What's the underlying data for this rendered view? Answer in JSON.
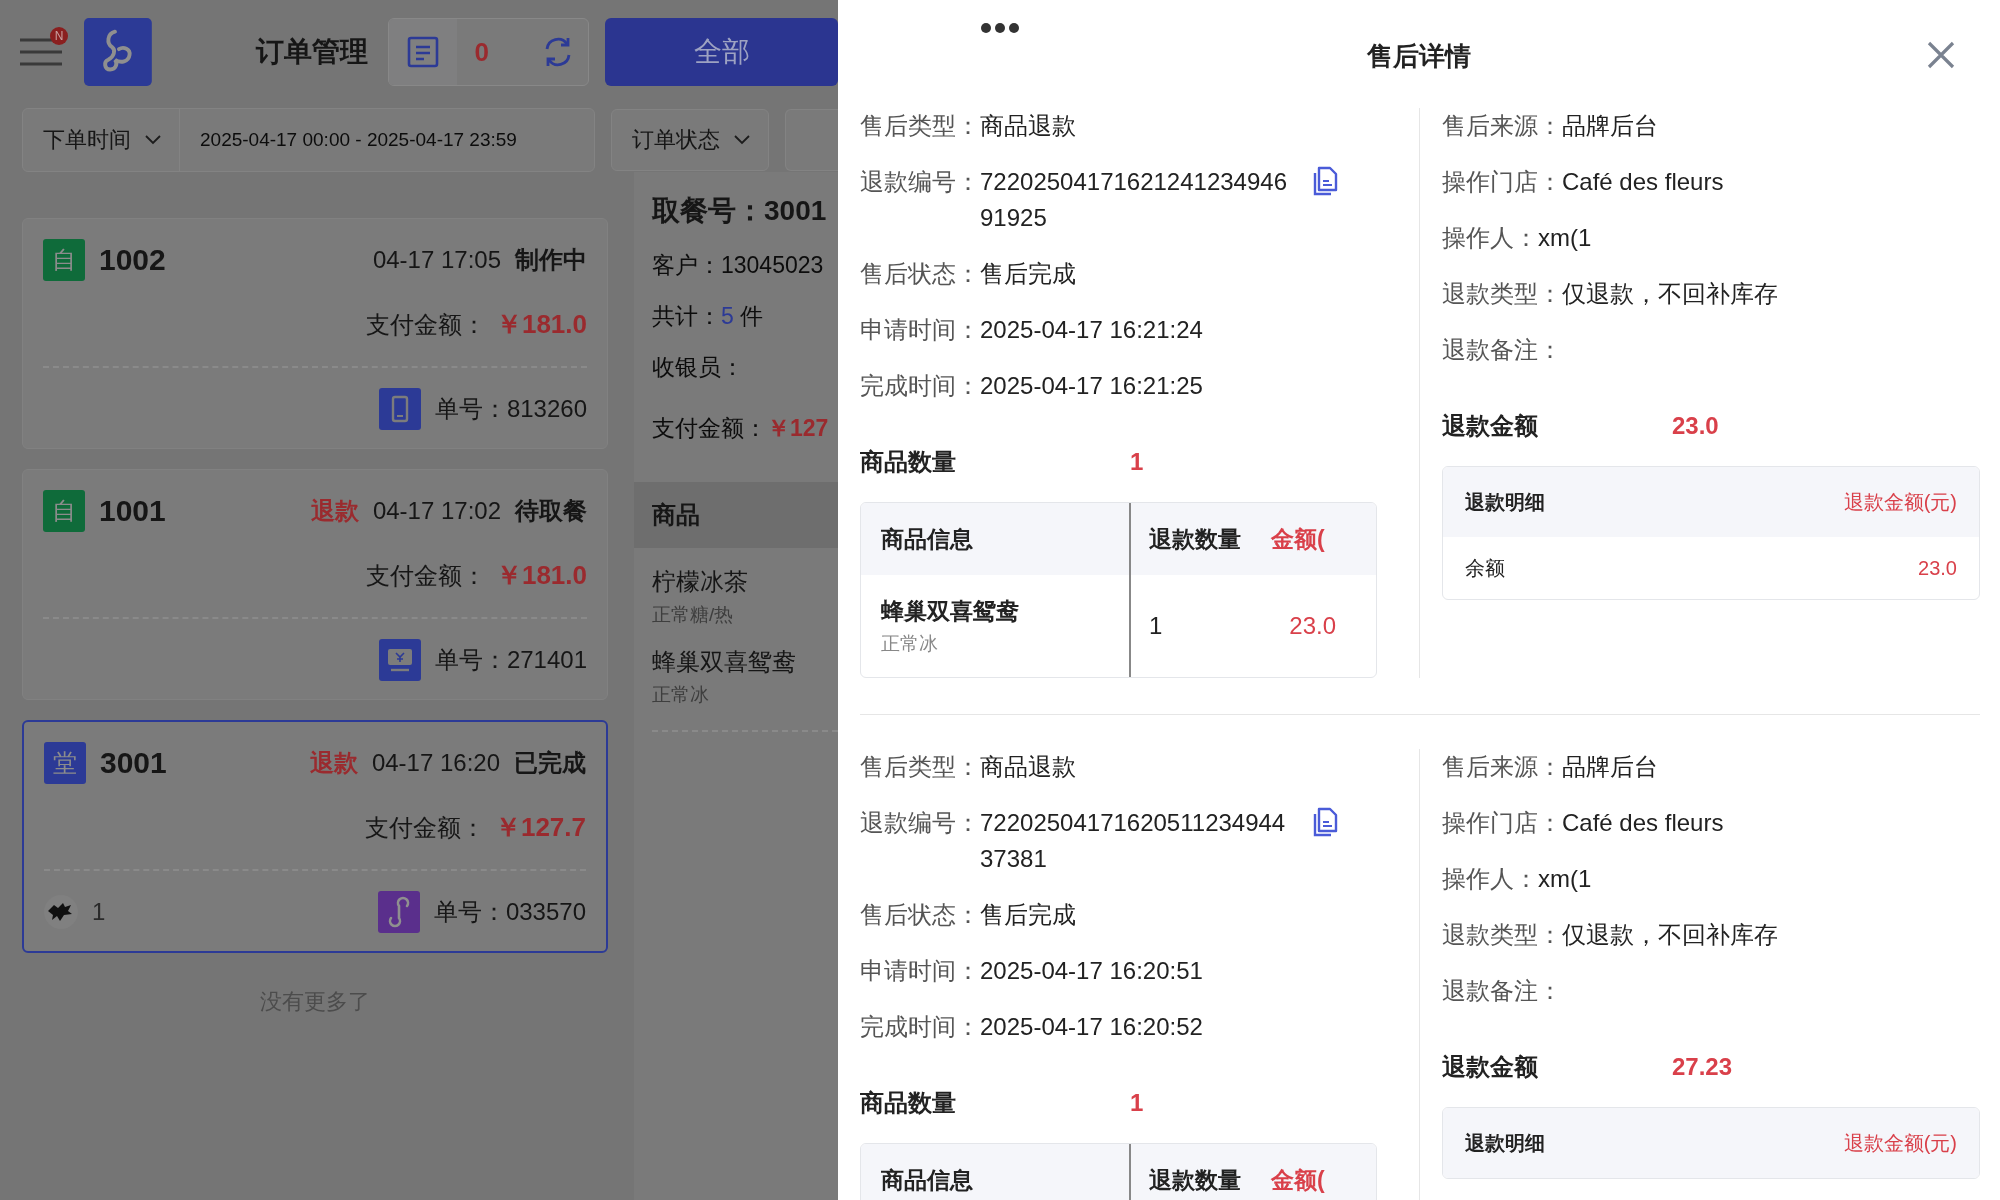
{
  "order_page": {
    "menu_badge": "N",
    "title": "订单管理",
    "pending_count": "0",
    "all_tab": "全部",
    "filters": [
      {
        "kind": "dropdown",
        "label": "下单时间"
      },
      {
        "kind": "range",
        "value": "2025-04-17 00:00 - 2025-04-17 23:59"
      },
      {
        "kind": "dropdown",
        "label": "订单状态"
      },
      {
        "kind": "cut"
      }
    ],
    "orders": [
      {
        "badge": "自",
        "color": "#0f6b3a",
        "number": "1002",
        "time": "04-17 17:05",
        "status": "制作中",
        "pay_label": "支付金额：",
        "amount": "￥181.0",
        "kind": "phone",
        "order_no_label": "单号：",
        "order_no": "813260",
        "selected": false
      },
      {
        "badge": "自",
        "color": "#0f6b3a",
        "number": "1001",
        "refund_tag": "退款",
        "time": "04-17 17:02",
        "status": "待取餐",
        "pay_label": "支付金额：",
        "amount": "￥181.0",
        "kind": "cashier",
        "order_no_label": "单号：",
        "order_no": "271401",
        "selected": false
      },
      {
        "badge": "堂",
        "color": "#2c3a96",
        "number": "3001",
        "refund_tag": "退款",
        "time": "04-17 16:20",
        "status": "已完成",
        "pay_label": "支付金额：",
        "amount": "￥127.7",
        "customer": "1",
        "kind": "mini_program",
        "order_no_label": "单号：",
        "order_no": "033570",
        "selected": true
      }
    ],
    "end_note": "没有更多了",
    "detail": {
      "pickup_label": "取餐号：",
      "pickup_no": "3001",
      "rows": [
        {
          "kind": "text",
          "label": "客户：",
          "value": "13045023"
        },
        {
          "kind": "count",
          "label": "共计：",
          "value": "5",
          "unit": "件"
        },
        {
          "kind": "text",
          "label": "收银员："
        },
        {
          "kind": "amount",
          "label": "支付金额：",
          "value": "￥127"
        }
      ],
      "items_header": "商品",
      "items": [
        {
          "name": "柠檬冰茶",
          "spec": "正常糖/热"
        },
        {
          "name": "蜂巢双喜鸳鸯",
          "spec": "正常冰"
        }
      ]
    }
  },
  "drawer": {
    "title": "售后详情",
    "records": [
      {
        "left": [
          {
            "kind": "text",
            "label": "售后类型：",
            "value": "商品退款"
          },
          {
            "kind": "id",
            "label": "退款编号：",
            "value": "7220250417162124123494691925"
          },
          {
            "kind": "text",
            "label": "售后状态：",
            "value": "售后完成"
          },
          {
            "kind": "text",
            "label": "申请时间：",
            "value": "2025-04-17 16:21:24"
          },
          {
            "kind": "text",
            "label": "完成时间：",
            "value": "2025-04-17 16:21:25"
          }
        ],
        "quantity_label": "商品数量",
        "quantity": "1",
        "table": {
          "columns": [
            "商品信息",
            "退款数量",
            "金额("
          ],
          "rows": [
            {
              "name": "蜂巢双喜鸳鸯",
              "spec": "正常冰",
              "qty": "1",
              "amount": "23.0"
            }
          ]
        },
        "right": [
          {
            "kind": "text",
            "label": "售后来源：",
            "value": "品牌后台"
          },
          {
            "kind": "text",
            "label": "操作门店：",
            "value": "Café des fleurs"
          },
          {
            "kind": "text",
            "label": "操作人：",
            "value": "xm(1"
          },
          {
            "kind": "text",
            "label": "退款类型：",
            "value": "仅退款，不回补库存"
          },
          {
            "kind": "text",
            "label": "退款备注："
          }
        ],
        "refund_label": "退款金额",
        "refund_amount": "23.0",
        "breakdown": {
          "columns": [
            "退款明细",
            "退款金额(元)"
          ],
          "rows": [
            {
              "method": "余额",
              "amount": "23.0"
            }
          ]
        }
      },
      {
        "left": [
          {
            "kind": "text",
            "label": "售后类型：",
            "value": "商品退款"
          },
          {
            "kind": "id",
            "label": "退款编号：",
            "value": "7220250417162051123494437381"
          },
          {
            "kind": "text",
            "label": "售后状态：",
            "value": "售后完成"
          },
          {
            "kind": "text",
            "label": "申请时间：",
            "value": "2025-04-17 16:20:51"
          },
          {
            "kind": "text",
            "label": "完成时间：",
            "value": "2025-04-17 16:20:52"
          }
        ],
        "quantity_label": "商品数量",
        "quantity": "1",
        "table": {
          "columns": [
            "商品信息",
            "退款数量",
            "金额("
          ]
        },
        "right": [
          {
            "kind": "text",
            "label": "售后来源：",
            "value": "品牌后台"
          },
          {
            "kind": "text",
            "label": "操作门店：",
            "value": "Café des fleurs"
          },
          {
            "kind": "text",
            "label": "操作人：",
            "value": "xm(1"
          },
          {
            "kind": "text",
            "label": "退款类型：",
            "value": "仅退款，不回补库存"
          },
          {
            "kind": "text",
            "label": "退款备注："
          }
        ],
        "refund_label": "退款金额",
        "refund_amount": "27.23",
        "breakdown": {
          "columns": [
            "退款明细",
            "退款金额(元)"
          ]
        }
      }
    ]
  }
}
